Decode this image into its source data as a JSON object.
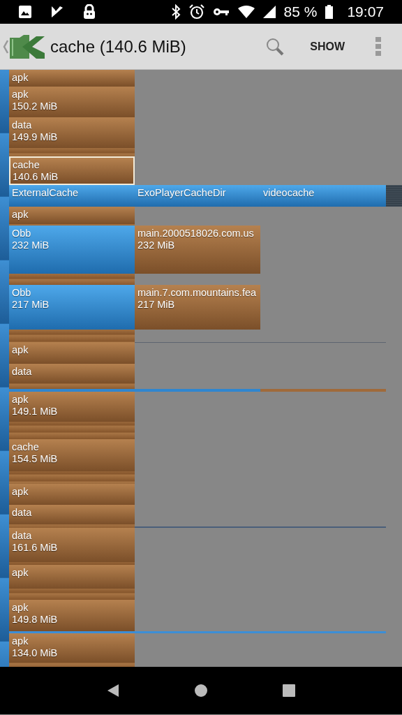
{
  "status_bar": {
    "battery": "85 %",
    "time": "19:07"
  },
  "app_bar": {
    "title": "cache (140.6 MiB)",
    "action": "SHOW"
  },
  "treemap": {
    "blocks": [
      {
        "kind": "file",
        "label": "apk",
        "selected": false
      },
      {
        "kind": "file",
        "label": "apk",
        "size": "150.2 MiB",
        "selected": false
      },
      {
        "kind": "file",
        "label": "data",
        "size": "149.9 MiB",
        "selected": false
      },
      {
        "kind": "file",
        "label": "cache",
        "size": "140.6 MiB",
        "selected": true
      },
      {
        "kind": "folder",
        "label": "ExternalCache",
        "selected": false,
        "children": [
          {
            "kind": "folder",
            "label": "ExoPlayerCacheDir",
            "selected": false,
            "children": [
              {
                "kind": "folder",
                "label": "videocache",
                "selected": false
              }
            ]
          }
        ]
      },
      {
        "kind": "file",
        "label": "apk",
        "selected": false
      },
      {
        "kind": "folder",
        "label": "Obb",
        "size": "232 MiB",
        "selected": false,
        "children": [
          {
            "kind": "file",
            "label": "main.2000518026.com.us",
            "size": "232 MiB",
            "selected": false
          }
        ]
      },
      {
        "kind": "folder",
        "label": "Obb",
        "size": "217 MiB",
        "selected": false,
        "children": [
          {
            "kind": "file",
            "label": "main.7.com.mountains.fea",
            "size": "217 MiB",
            "selected": false
          }
        ]
      },
      {
        "kind": "file",
        "label": "apk",
        "selected": false
      },
      {
        "kind": "file",
        "label": "data",
        "selected": false
      },
      {
        "kind": "file",
        "label": "apk",
        "size": "149.1 MiB",
        "selected": false
      },
      {
        "kind": "file",
        "label": "cache",
        "size": "154.5 MiB",
        "selected": false
      },
      {
        "kind": "file",
        "label": "apk",
        "selected": false
      },
      {
        "kind": "file",
        "label": "data",
        "selected": false
      },
      {
        "kind": "file",
        "label": "data",
        "size": "161.6 MiB",
        "selected": false
      },
      {
        "kind": "file",
        "label": "apk",
        "selected": false
      },
      {
        "kind": "file",
        "label": "apk",
        "size": "149.8 MiB",
        "selected": false
      },
      {
        "kind": "file",
        "label": "apk",
        "size": "134.0 MiB",
        "selected": false
      }
    ]
  }
}
